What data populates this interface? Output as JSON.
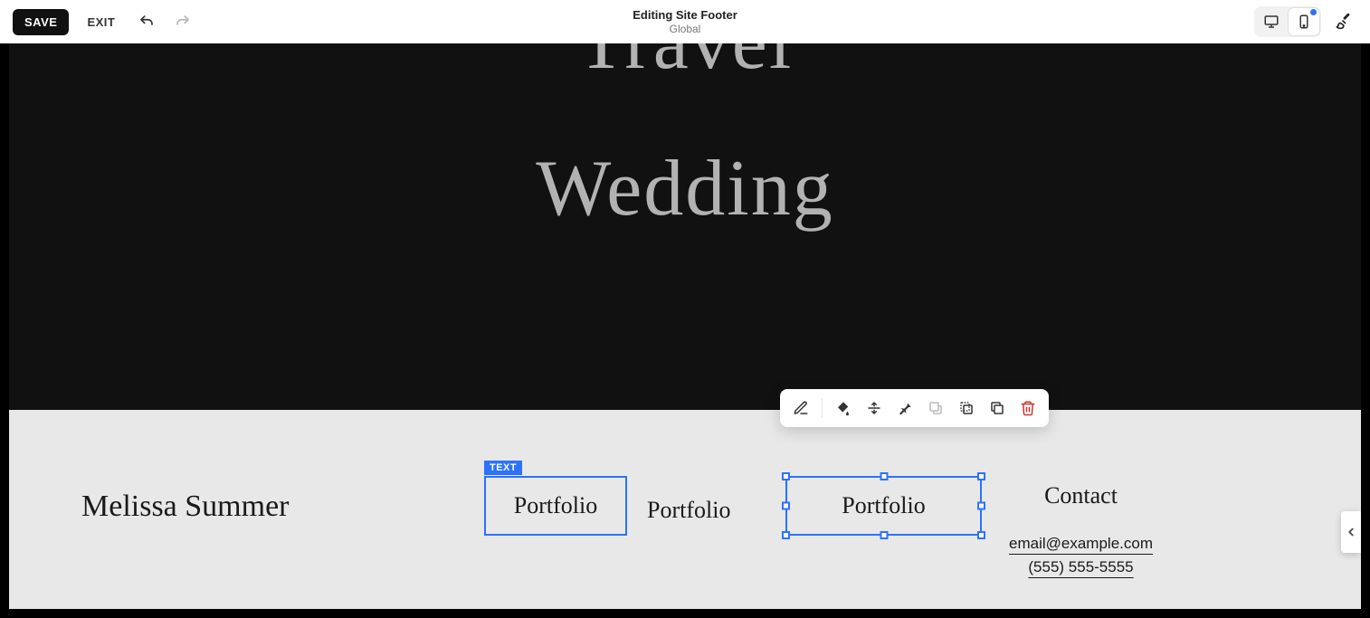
{
  "toolbar": {
    "save_label": "SAVE",
    "exit_label": "EXIT",
    "title": "Editing Site Footer",
    "subtitle": "Global"
  },
  "hero": {
    "word1": "Travel",
    "word2": "Wedding"
  },
  "footer": {
    "name": "Melissa Summer",
    "block_type_label": "TEXT",
    "portfolio1": "Portfolio",
    "portfolio2": "Portfolio",
    "portfolio3": "Portfolio",
    "contact_title": "Contact",
    "email": "email@example.com",
    "phone": "(555) 555-5555"
  }
}
